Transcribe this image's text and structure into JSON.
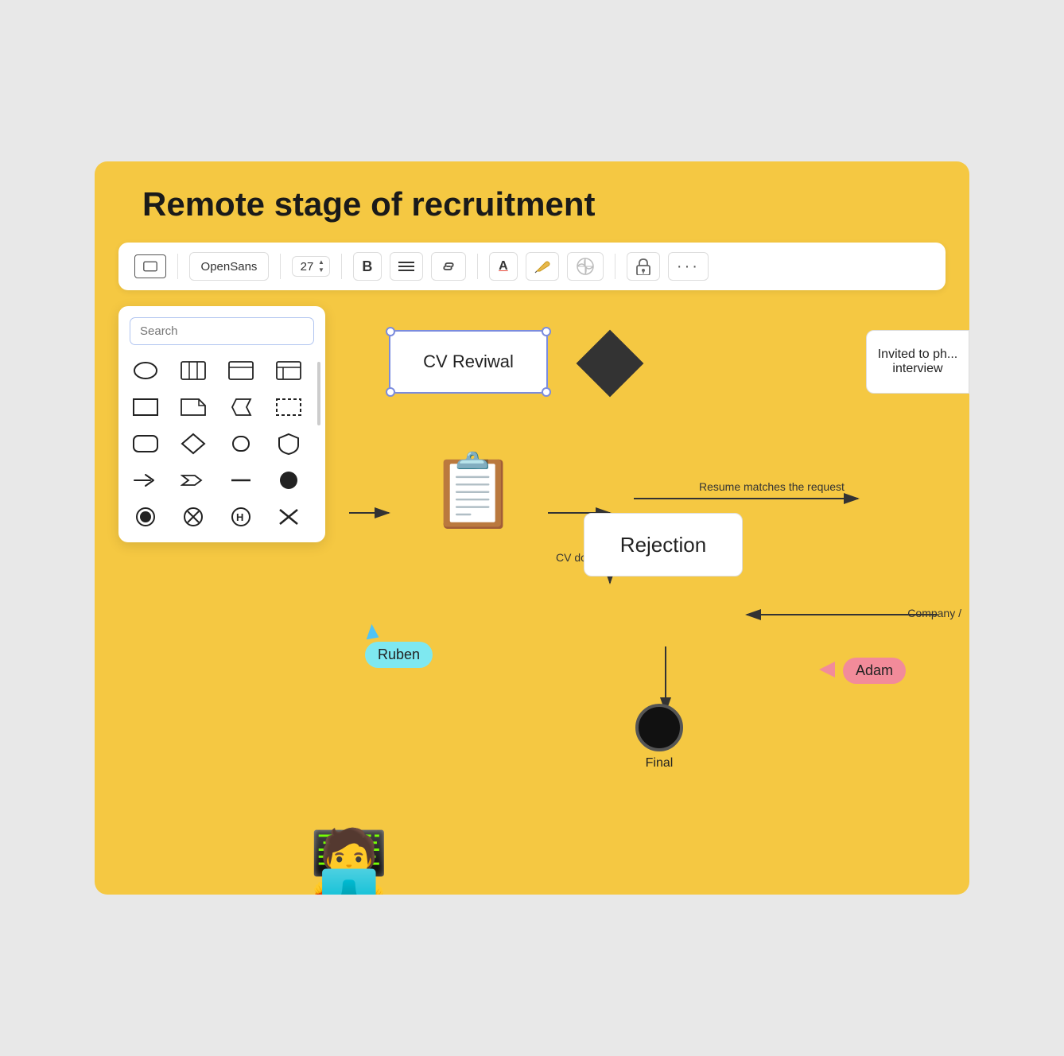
{
  "page": {
    "title": "Remote stage of recruitment",
    "background_color": "#f5c842"
  },
  "toolbar": {
    "shape_label": "□",
    "font_label": "OpenSans",
    "font_size": "27",
    "bold_label": "B",
    "align_label": "≡",
    "link_label": "🔗",
    "text_color_label": "A",
    "pen_label": "✏",
    "grid_label": "⬡",
    "lock_label": "🔓",
    "more_label": "···"
  },
  "shapes_panel": {
    "search_placeholder": "Search",
    "shapes": [
      "ellipse",
      "columns",
      "card1",
      "card2",
      "rectangle",
      "folded",
      "chevron-left",
      "dashed-rect",
      "rounded-rect",
      "diamond",
      "stadium",
      "shield",
      "arrow-right",
      "arrow-chevron",
      "line",
      "circle-filled",
      "circle-target",
      "circle-x",
      "circle-h",
      "x-mark"
    ]
  },
  "diagram": {
    "nodes": [
      {
        "id": "cv-revival",
        "label": "CV Reviwal",
        "type": "rounded-rect"
      },
      {
        "id": "diamond",
        "label": "",
        "type": "diamond"
      },
      {
        "id": "rejection",
        "label": "Rejection",
        "type": "rounded-rect"
      },
      {
        "id": "final",
        "label": "Final",
        "type": "end-circle"
      },
      {
        "id": "invited",
        "label": "Invited to ph... interview",
        "type": "rounded-rect"
      }
    ],
    "arrows": [
      {
        "id": "arr1",
        "label": ""
      },
      {
        "id": "arr2",
        "label": "Resume matches the request"
      },
      {
        "id": "arr3",
        "label": "CV doesn't fit"
      },
      {
        "id": "arr4",
        "label": "Company /"
      },
      {
        "id": "arr5",
        "label": ""
      }
    ]
  },
  "users": [
    {
      "name": "Ruben",
      "color": "#7ee8f0"
    },
    {
      "name": "Adam",
      "color": "#f28b9a"
    }
  ]
}
